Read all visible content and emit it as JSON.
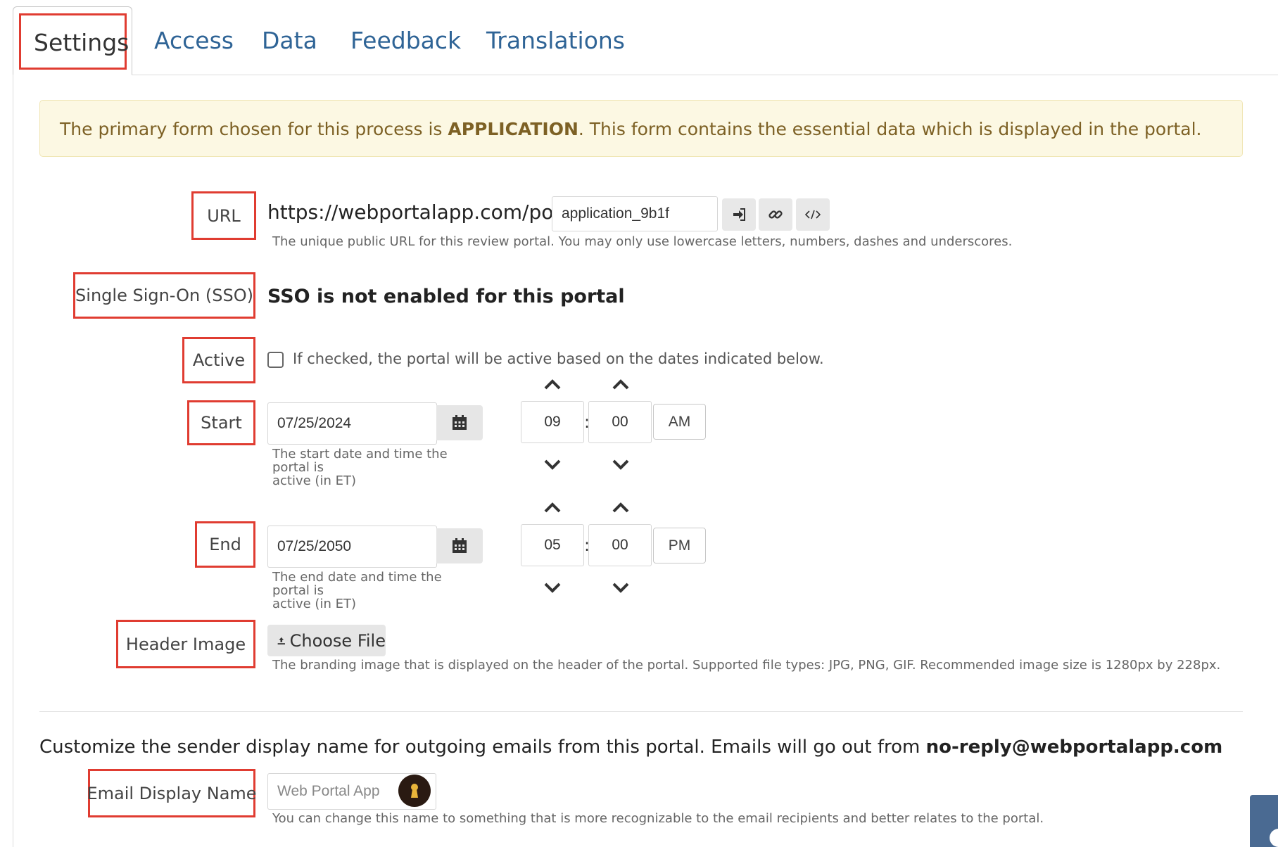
{
  "tabs": [
    {
      "label": "Settings",
      "active": true
    },
    {
      "label": "Access"
    },
    {
      "label": "Data"
    },
    {
      "label": "Feedback"
    },
    {
      "label": "Translations"
    }
  ],
  "notice": {
    "prefix": "The primary form chosen for this process is ",
    "form_name": "APPLICATION",
    "suffix": ". This form contains the essential data which is displayed in the portal."
  },
  "url": {
    "label": "URL",
    "prefix": "https://webportalapp.com/portal/",
    "slug": "application_9b1f",
    "help": "The unique public URL for this review portal. You may only use lowercase letters, numbers, dashes and underscores.",
    "buttons": [
      "sign-in-icon",
      "link-icon",
      "code-icon"
    ]
  },
  "sso": {
    "label": "Single Sign-On (SSO)",
    "status": "SSO is not enabled for this portal"
  },
  "active": {
    "label": "Active",
    "checked": false,
    "help": "If checked, the portal will be active based on the dates indicated below."
  },
  "start": {
    "label": "Start",
    "date": "07/25/2024",
    "hour": "09",
    "minute": "00",
    "ampm": "AM",
    "help_line1": "The start date and time the portal is",
    "help_line2": "active (in ET)"
  },
  "end": {
    "label": "End",
    "date": "07/25/2050",
    "hour": "05",
    "minute": "00",
    "ampm": "PM",
    "help_line1": "The end date and time the portal is",
    "help_line2": "active (in ET)"
  },
  "header_image": {
    "label": "Header Image",
    "button": "Choose File",
    "help": "The branding image that is displayed on the header of the portal. Supported file types: JPG, PNG, GIF. Recommended image size is 1280px by 228px."
  },
  "email": {
    "intro": "Customize the sender display name for outgoing emails from this portal. Emails will go out from ",
    "address": "no-reply@webportalapp.com",
    "label": "Email Display Name",
    "placeholder": "Web Portal App",
    "help": "You can change this name to something that is more recognizable to the email recipients and better relates to the portal."
  },
  "colors": {
    "highlight": "#e03c31",
    "link": "#2f6496",
    "notice_bg": "#fcf8e3",
    "notice_text": "#7d6125"
  }
}
